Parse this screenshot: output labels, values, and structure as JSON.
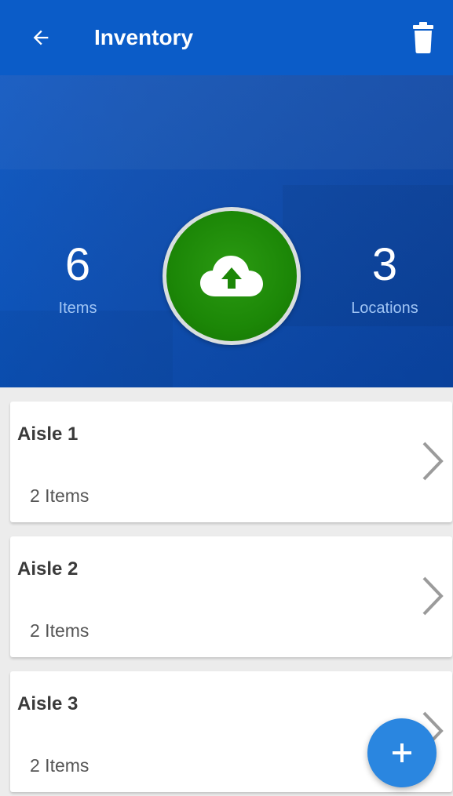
{
  "header": {
    "back_icon": "arrow-left-icon",
    "title": "Inventory",
    "delete_icon": "trash-icon"
  },
  "stats": {
    "items": {
      "value": "6",
      "label": "Items"
    },
    "locations": {
      "value": "3",
      "label": "Locations"
    }
  },
  "upload_button": {
    "icon": "cloud-upload-icon"
  },
  "locations": [
    {
      "name": "Aisle 1",
      "count": "2 Items"
    },
    {
      "name": "Aisle 2",
      "count": "2 Items"
    },
    {
      "name": "Aisle 3",
      "count": "2 Items"
    }
  ],
  "fab": {
    "icon": "plus-icon"
  },
  "colors": {
    "primary": "#0b5cc8",
    "upload_green": "#1c8707",
    "fab_blue": "#2a86e0",
    "stat_label": "#9fc4f4"
  }
}
